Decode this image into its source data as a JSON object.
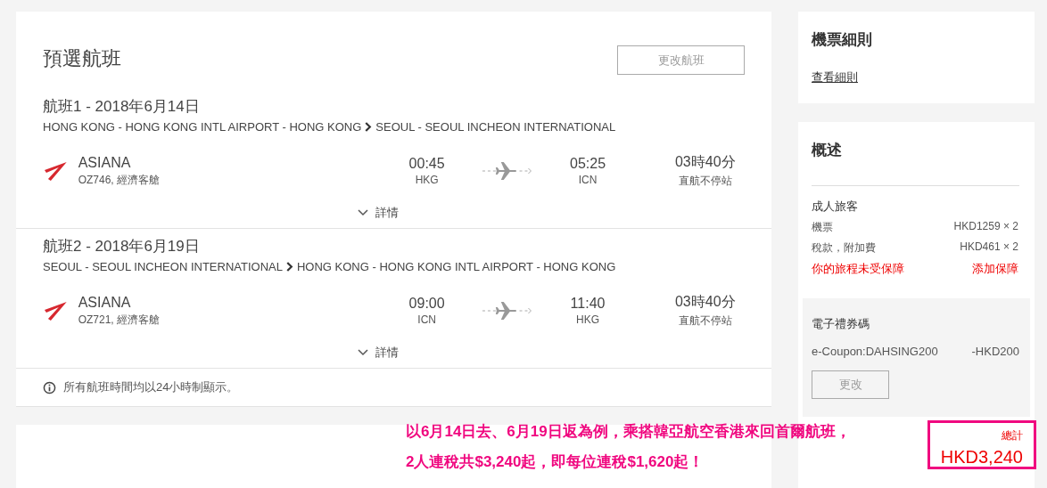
{
  "main": {
    "title": "預選航班",
    "change_button": "更改航班",
    "flights": [
      {
        "heading": "航班1 - 2018年6月14日",
        "origin": "HONG KONG - HONG KONG INTL AIRPORT - HONG KONG",
        "destination": "SEOUL - SEOUL INCHEON INTERNATIONAL",
        "airline": "ASIANA",
        "flight_info": "OZ746, 經濟客艙",
        "depart_time": "00:45",
        "depart_code": "HKG",
        "arrive_time": "05:25",
        "arrive_code": "ICN",
        "duration": "03時40分",
        "stops": "直航不停站",
        "details": "詳情"
      },
      {
        "heading": "航班2 - 2018年6月19日",
        "origin": "SEOUL - SEOUL INCHEON INTERNATIONAL",
        "destination": "HONG KONG - HONG KONG INTL AIRPORT - HONG KONG",
        "airline": "ASIANA",
        "flight_info": "OZ721, 經濟客艙",
        "depart_time": "09:00",
        "depart_code": "ICN",
        "arrive_time": "11:40",
        "arrive_code": "HKG",
        "duration": "03時40分",
        "stops": "直航不停站",
        "details": "詳情"
      }
    ],
    "note": "所有航班時間均以24小時制顯示。"
  },
  "rules": {
    "title": "機票細則",
    "link": "查看細則"
  },
  "summary": {
    "title": "概述",
    "section": "成人旅客",
    "lines": [
      {
        "label": "機票",
        "value": "HKD1259 × 2"
      },
      {
        "label": "稅款，附加費",
        "value": "HKD461 × 2"
      }
    ],
    "warning": "你的旅程未受保障",
    "add_link": "添加保障",
    "coupon": {
      "title": "電子禮券碼",
      "code": "e-Coupon:DAHSING200",
      "amount": "-HKD200",
      "button": "更改"
    },
    "total_label": "總計",
    "total": "HKD3,240"
  },
  "annotation": [
    "以6月14日去、6月19日返為例，乘搭韓亞航空香港來回首爾航班，",
    "2人連稅共$3,240起，即每位連稅$1,620起！"
  ]
}
